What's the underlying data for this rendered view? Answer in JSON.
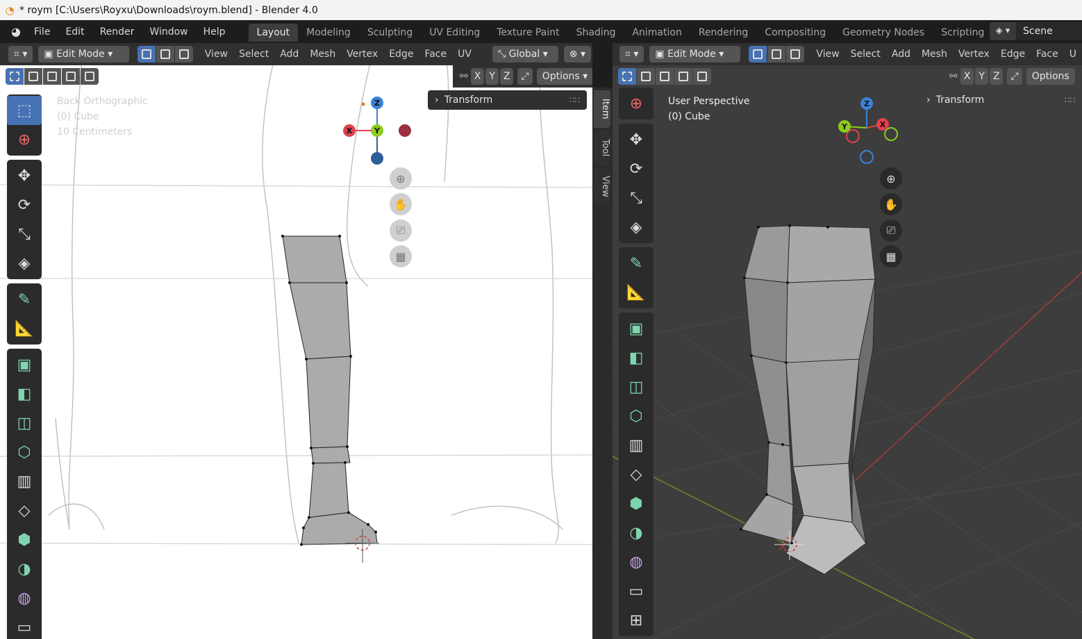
{
  "window": {
    "title": "* roym [C:\\Users\\Royxu\\Downloads\\roym.blend] - Blender 4.0"
  },
  "menubar": {
    "items": [
      "File",
      "Edit",
      "Render",
      "Window",
      "Help"
    ],
    "workspaces": [
      "Layout",
      "Modeling",
      "Sculpting",
      "UV Editing",
      "Texture Paint",
      "Shading",
      "Animation",
      "Rendering",
      "Compositing",
      "Geometry Nodes",
      "Scripting"
    ],
    "active_workspace": "Layout",
    "add_symbol": "+",
    "scene_label": "Scene"
  },
  "left_viewport": {
    "mode": "Edit Mode",
    "menus": [
      "View",
      "Select",
      "Add",
      "Mesh",
      "Vertex",
      "Edge",
      "Face",
      "UV"
    ],
    "orientation": "Global",
    "axes": [
      "X",
      "Y",
      "Z"
    ],
    "options_label": "Options",
    "info": [
      "Back Orthographic",
      "(0) Cube",
      "10 Centimeters"
    ],
    "transform_label": "Transform",
    "gizmo": {
      "z": "Z",
      "y": "Y",
      "x": "X"
    },
    "sidebar_tabs": [
      "Item",
      "Tool",
      "View"
    ]
  },
  "right_viewport": {
    "mode": "Edit Mode",
    "menus": [
      "View",
      "Select",
      "Add",
      "Mesh",
      "Vertex",
      "Edge",
      "Face",
      "U"
    ],
    "axes": [
      "X",
      "Y",
      "Z"
    ],
    "options_label": "Options",
    "info": [
      "User Perspective",
      "(0) Cube"
    ],
    "transform_label": "Transform",
    "gizmo": {
      "z": "Z",
      "y": "Y",
      "x": "X"
    }
  },
  "colors": {
    "accent_blue": "#4772b3",
    "axis_x": "#e0404f",
    "axis_y": "#8ccc1c",
    "axis_z": "#3b82d6",
    "header_bg": "#303030"
  }
}
